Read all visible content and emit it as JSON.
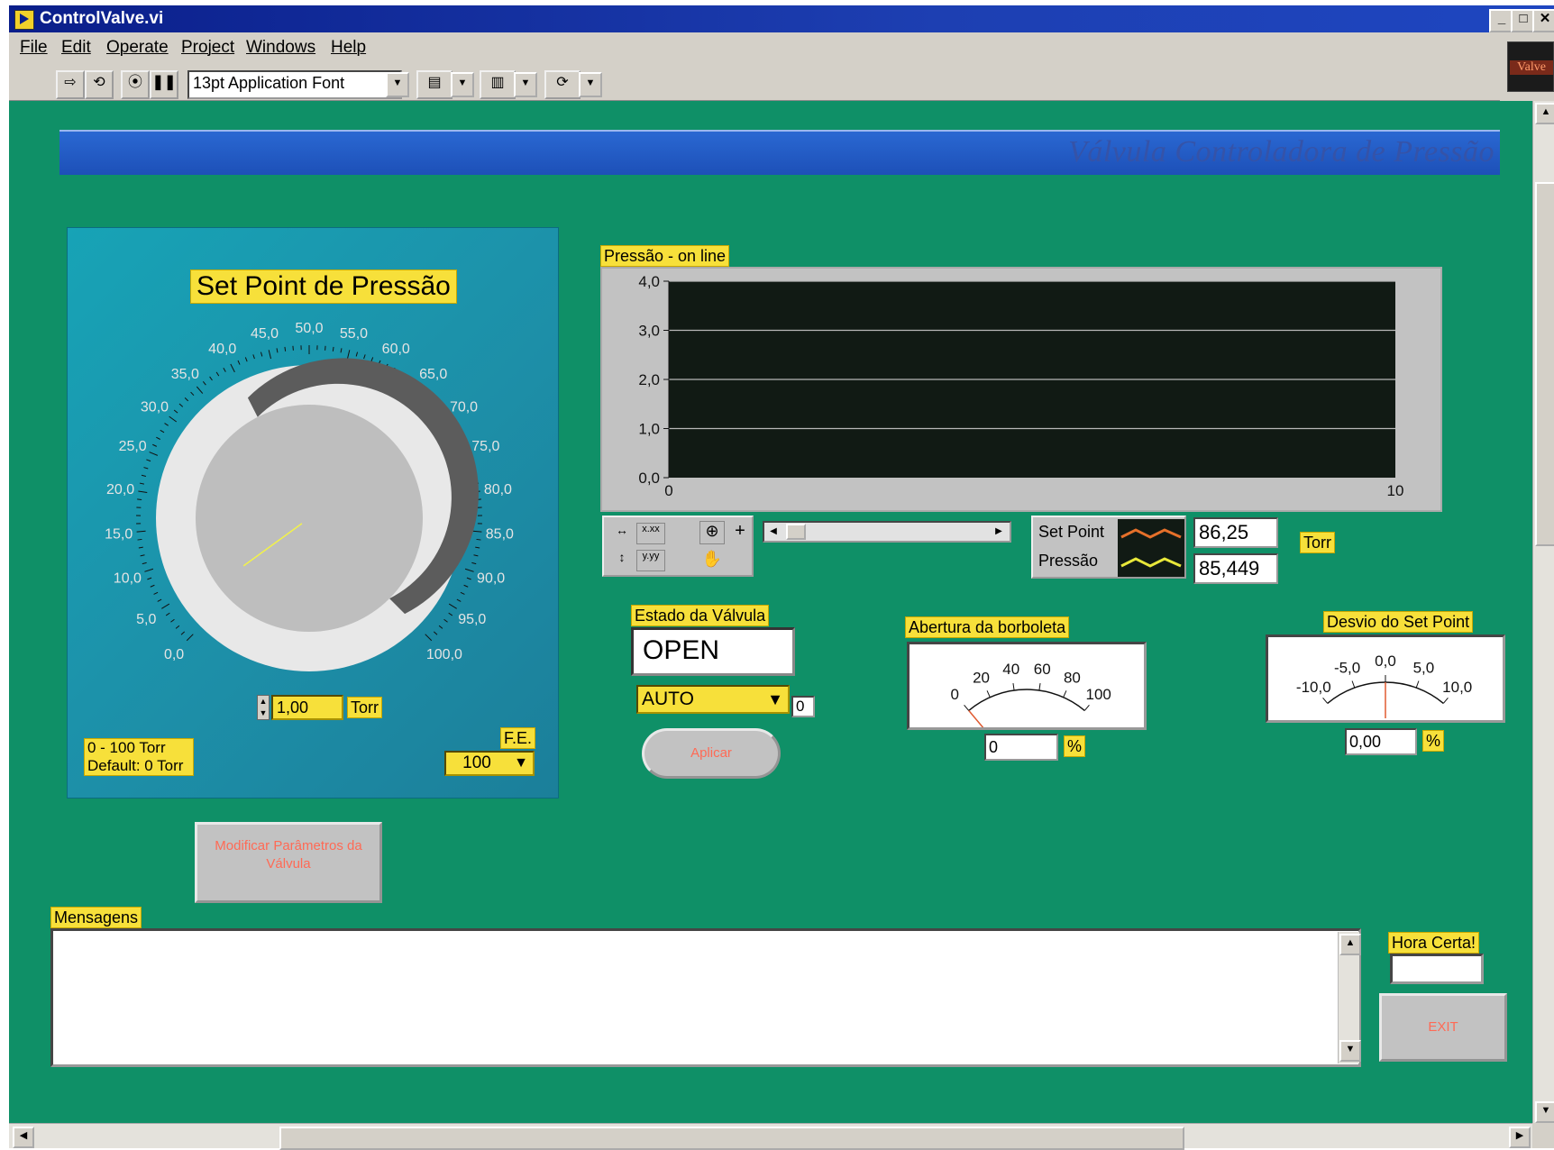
{
  "window": {
    "title": "ControlValve.vi",
    "controls": [
      "_",
      "□",
      "✕"
    ]
  },
  "menu": [
    "File",
    "Edit",
    "Operate",
    "Project",
    "Windows",
    "Help"
  ],
  "toolbar": {
    "font_selector": "13pt Application Font"
  },
  "valve_icon_text": "Valve",
  "banner": {
    "title": "Válvula Controladora de Pressão"
  },
  "setpoint": {
    "label": "Set Point de Pressão",
    "scale_ticks": [
      "0,0",
      "5,0",
      "10,0",
      "15,0",
      "20,0",
      "25,0",
      "30,0",
      "35,0",
      "40,0",
      "45,0",
      "50,0",
      "55,0",
      "60,0",
      "65,0",
      "70,0",
      "75,0",
      "80,0",
      "85,0",
      "90,0",
      "95,0",
      "100,0"
    ],
    "knob_value": 40,
    "numeric_value": "1,00",
    "unit": "Torr",
    "range_note_line1": "0 - 100 Torr",
    "range_note_line2": "Default: 0 Torr",
    "fe_label": "F.E.",
    "fe_value": "100"
  },
  "graph": {
    "label": "Pressão - on line",
    "y_ticks": [
      "4,0",
      "3,0",
      "2,0",
      "1,0",
      "0,0"
    ],
    "x_ticks": [
      "0",
      "10"
    ],
    "legend": [
      {
        "name": "Set Point",
        "value": "86,25",
        "color": "#e5702a"
      },
      {
        "name": "Pressão",
        "value": "85,449",
        "color": "#e8e83a"
      }
    ],
    "unit": "Torr"
  },
  "chart_data": {
    "type": "line",
    "title": "Pressão - on line",
    "x": [
      0,
      10
    ],
    "xlim": [
      0,
      10
    ],
    "ylim": [
      0,
      4
    ],
    "grid": true,
    "series": [
      {
        "name": "Set Point",
        "values": []
      },
      {
        "name": "Pressão",
        "values": []
      }
    ]
  },
  "valve_state": {
    "label": "Estado da Válvula",
    "value": "OPEN",
    "mode": "AUTO",
    "mode_index": "0",
    "apply_button": "Aplicar"
  },
  "butterfly": {
    "label": "Abertura da borboleta",
    "ticks": [
      "0",
      "20",
      "40",
      "60",
      "80",
      "100"
    ],
    "value": "0",
    "unit": "%",
    "needle_value": 0
  },
  "deviation": {
    "label": "Desvio do Set Point",
    "ticks": [
      "-10,0",
      "-5,0",
      "0,0",
      "5,0",
      "10,0"
    ],
    "value": "0,00",
    "unit": "%",
    "needle_value": 0
  },
  "modify_button": {
    "label": "Modificar Parâmetros da Válvula"
  },
  "messages": {
    "label": "Mensagens",
    "content": ""
  },
  "clock": {
    "label": "Hora Certa!",
    "value": ""
  },
  "exit_button": {
    "label": "EXIT"
  }
}
